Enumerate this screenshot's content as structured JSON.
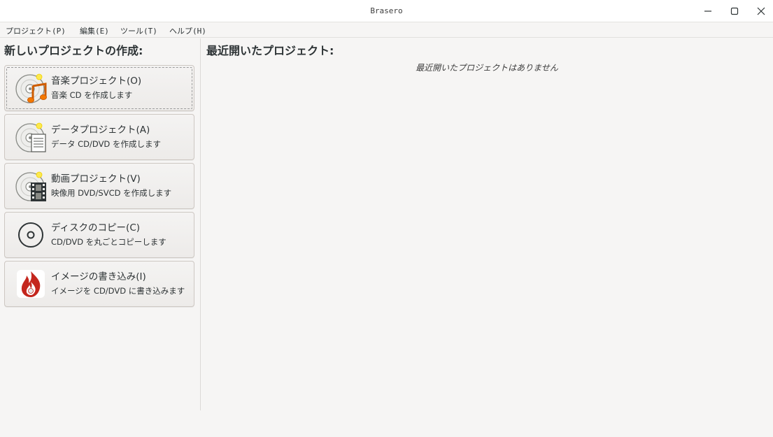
{
  "window": {
    "title": "Brasero",
    "controls": [
      "minimize-icon",
      "maximize-icon",
      "close-icon"
    ]
  },
  "menu": {
    "items": [
      {
        "label": "プロジェクト(P)"
      },
      {
        "label": "編集(E)"
      },
      {
        "label": "ツール(T)"
      },
      {
        "label": "ヘルプ(H)"
      }
    ]
  },
  "new_project": {
    "heading": "新しいプロジェクトの作成:",
    "buttons": [
      {
        "title": "音楽プロジェクト(O)",
        "description": "音楽 CD を作成します",
        "icon": "music-disc-icon"
      },
      {
        "title": "データプロジェクト(A)",
        "description": "データ CD/DVD を作成します",
        "icon": "data-disc-icon"
      },
      {
        "title": "動画プロジェクト(V)",
        "description": "映像用 DVD/SVCD を作成します",
        "icon": "video-disc-icon"
      },
      {
        "title": "ディスクのコピー(C)",
        "description": "CD/DVD を丸ごとコピーします",
        "icon": "disc-copy-icon"
      },
      {
        "title": "イメージの書き込み(I)",
        "description": "イメージを CD/DVD に書き込みます",
        "icon": "burn-image-icon"
      }
    ]
  },
  "recent": {
    "heading": "最近開いたプロジェクト:",
    "empty_message": "最近開いたプロジェクトはありません"
  },
  "colors": {
    "background": "#f6f5f4",
    "button_border": "#cdc7c2",
    "text": "#2e3436",
    "music_note": "#e8841c",
    "burn_red": "#c4261d"
  }
}
